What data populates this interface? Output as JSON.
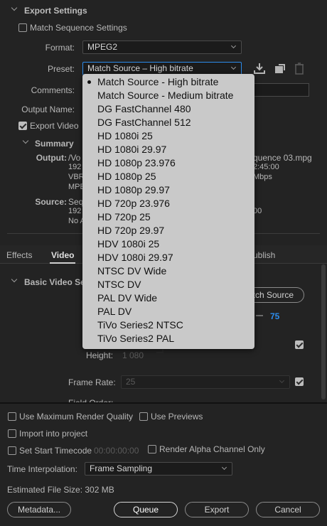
{
  "export_settings": {
    "header": "Export Settings",
    "match_sequence": {
      "label": "Match Sequence Settings",
      "checked": false
    },
    "format": {
      "label": "Format:",
      "value": "MPEG2"
    },
    "preset": {
      "label": "Preset:",
      "value": "Match Source – High bitrate"
    },
    "comments_label": "Comments:",
    "output_name_label": "Output Name:",
    "export_video": {
      "label": "Export Video",
      "checked": true
    },
    "summary": {
      "header": "Summary",
      "output_label": "Output:",
      "output_lines": [
        "/Vo",
        "192",
        "VBR",
        "MPE"
      ],
      "output_right": [
        "quence 03.mpg",
        "2:45:00",
        "Mbps"
      ],
      "source_label": "Source:",
      "source_lines": [
        "Seq",
        "192",
        "No A"
      ],
      "source_right": [
        "00"
      ]
    }
  },
  "preset_dropdown": {
    "selected_index": 0,
    "items": [
      "Match Source - High bitrate",
      "Match Source - Medium bitrate",
      "DG FastChannel 480",
      "DG FastChannel 512",
      "HD 1080i 25",
      "HD 1080i 29.97",
      "HD 1080p 23.976",
      "HD 1080p 25",
      "HD 1080p 29.97",
      "HD 720p 23.976",
      "HD 720p 25",
      "HD 720p 29.97",
      "HDV 1080i 25",
      "HDV 1080i 29.97",
      "NTSC DV Wide",
      "NTSC DV",
      "PAL DV Wide",
      "PAL DV",
      "TiVo Series2 NTSC",
      "TiVo Series2 PAL"
    ]
  },
  "tabs": {
    "effects": "Effects",
    "video": "Video",
    "publish": "ublish"
  },
  "basic_video": {
    "header": "Basic Video Se",
    "match_source_button": "tch Source",
    "quality_value": "75",
    "height_label": "Height:",
    "height_value": "1 080",
    "frame_rate_label": "Frame Rate:",
    "frame_rate_value": "25",
    "field_order_label": "Field Order:"
  },
  "bottom": {
    "max_render_quality": "Use Maximum Render Quality",
    "use_previews": "Use Previews",
    "import_into_project": "Import into project",
    "set_start_timecode": "Set Start Timecode",
    "timecode_value": "00:00:00:00",
    "render_alpha": "Render Alpha Channel Only",
    "time_interpolation_label": "Time Interpolation:",
    "time_interpolation_value": "Frame Sampling",
    "estimated_file_size": "Estimated File Size:  302 MB",
    "metadata_button": "Metadata...",
    "queue_button": "Queue",
    "export_button": "Export",
    "cancel_button": "Cancel"
  },
  "colors": {
    "accent_blue": "#2d8ceb",
    "panel_bg": "#232323",
    "dropdown_bg": "#c9c9c9"
  }
}
